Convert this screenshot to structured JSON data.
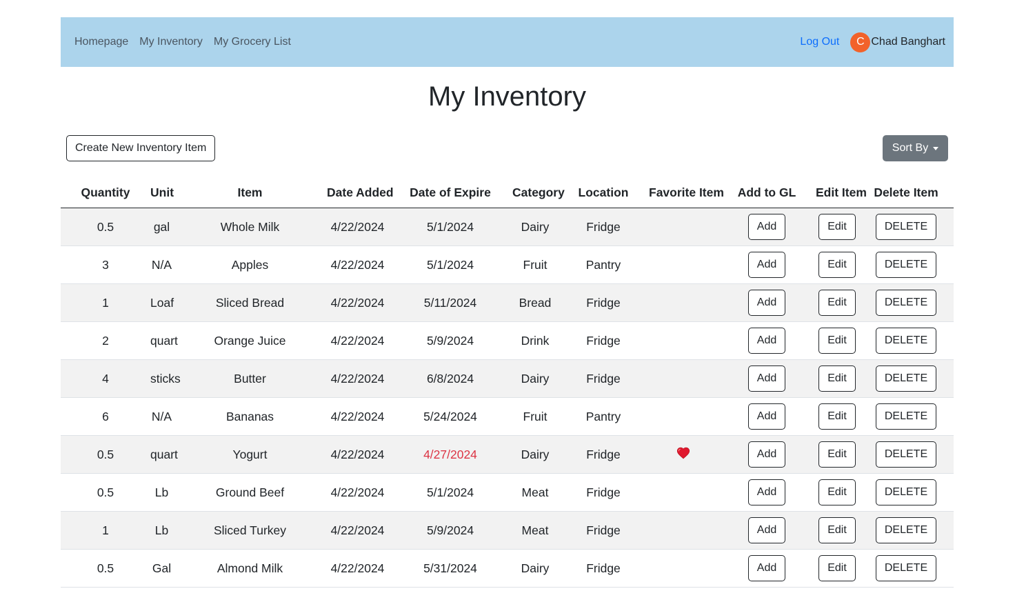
{
  "nav": {
    "links": [
      "Homepage",
      "My Inventory",
      "My Grocery List"
    ],
    "logout": "Log Out",
    "avatar_initial": "C",
    "user_name": "Chad Banghart"
  },
  "page": {
    "title": "My Inventory",
    "create_button": "Create New Inventory Item",
    "sort_button": "Sort By"
  },
  "table": {
    "headers": [
      "Quantity",
      "Unit",
      "Item",
      "Date Added",
      "Date of Expire",
      "Category",
      "Location",
      "Favorite Item",
      "Add to GL",
      "Edit Item",
      "Delete Item"
    ],
    "add_label": "Add",
    "edit_label": "Edit",
    "delete_label": "DELETE",
    "expired_color": "#dc3545",
    "favorite_icon": "heart-icon",
    "rows": [
      {
        "quantity": "0.5",
        "unit": "gal",
        "item": "Whole Milk",
        "date_added": "4/22/2024",
        "date_expire": "5/1/2024",
        "category": "Dairy",
        "location": "Fridge",
        "favorite": false,
        "expired": false
      },
      {
        "quantity": "3",
        "unit": "N/A",
        "item": "Apples",
        "date_added": "4/22/2024",
        "date_expire": "5/1/2024",
        "category": "Fruit",
        "location": "Pantry",
        "favorite": false,
        "expired": false
      },
      {
        "quantity": "1",
        "unit": "Loaf",
        "item": "Sliced Bread",
        "date_added": "4/22/2024",
        "date_expire": "5/11/2024",
        "category": "Bread",
        "location": "Fridge",
        "favorite": false,
        "expired": false
      },
      {
        "quantity": "2",
        "unit": "quart",
        "item": "Orange Juice",
        "date_added": "4/22/2024",
        "date_expire": "5/9/2024",
        "category": "Drink",
        "location": "Fridge",
        "favorite": false,
        "expired": false
      },
      {
        "quantity": "4",
        "unit": "sticks",
        "item": "Butter",
        "date_added": "4/22/2024",
        "date_expire": "6/8/2024",
        "category": "Dairy",
        "location": "Fridge",
        "favorite": false,
        "expired": false
      },
      {
        "quantity": "6",
        "unit": "N/A",
        "item": "Bananas",
        "date_added": "4/22/2024",
        "date_expire": "5/24/2024",
        "category": "Fruit",
        "location": "Pantry",
        "favorite": false,
        "expired": false
      },
      {
        "quantity": "0.5",
        "unit": "quart",
        "item": "Yogurt",
        "date_added": "4/22/2024",
        "date_expire": "4/27/2024",
        "category": "Dairy",
        "location": "Fridge",
        "favorite": true,
        "expired": true
      },
      {
        "quantity": "0.5",
        "unit": "Lb",
        "item": "Ground Beef",
        "date_added": "4/22/2024",
        "date_expire": "5/1/2024",
        "category": "Meat",
        "location": "Fridge",
        "favorite": false,
        "expired": false
      },
      {
        "quantity": "1",
        "unit": "Lb",
        "item": "Sliced Turkey",
        "date_added": "4/22/2024",
        "date_expire": "5/9/2024",
        "category": "Meat",
        "location": "Fridge",
        "favorite": false,
        "expired": false
      },
      {
        "quantity": "0.5",
        "unit": "Gal",
        "item": "Almond Milk",
        "date_added": "4/22/2024",
        "date_expire": "5/31/2024",
        "category": "Dairy",
        "location": "Fridge",
        "favorite": false,
        "expired": false
      }
    ]
  }
}
